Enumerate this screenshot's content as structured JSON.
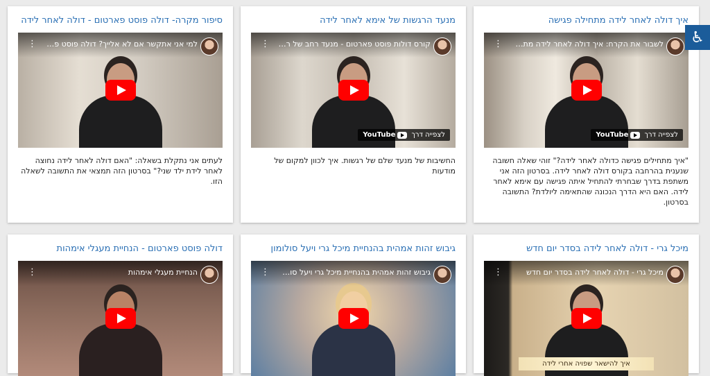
{
  "cards": [
    {
      "title": "איך דולה לאחר לידה מתחילה פגישה",
      "video_title": "לשבור את הקרח: איך דולה לאחר לידה מתחיל...",
      "watch_on": "לצפייה דרך",
      "youtube": "YouTube",
      "description": "\"איך מתחילים פגישה כדולה לאחר לידה?\" זוהי שאלה חשובה שנענית בהרחבה בקורס דולה לאחר לידה. בסרטון הזה אני משתפת בדרך שבחרתי להתחיל איתה פגישה עם אימא לאחר לידה. האם היא הדרך הנכונה שהתאימה ליולדת? התשובה בסרטון."
    },
    {
      "title": "מנעד הרגשות של אימא לאחר לידה",
      "video_title": "קורס דולות פוסט פארטום - מנעד רחב של רגשות",
      "watch_on": "לצפייה דרך",
      "youtube": "YouTube",
      "description": "החשיבות של מנעד שלם של רגשות. איך לכוון למקום של מודעות"
    },
    {
      "title": "סיפור מקרה- דולה פוסט פארטום - דולה לאחר לידה",
      "video_title": "למי אני אתקשר אם לא אלייך? דולה פוסט פארט...",
      "description": "לעתים אני נתקלת בשאלה: \"האם דולה לאחר לידה נחוצה לאחר לידת ילד שני?\" בסרטון הזה תמצאי את התשובה לשאלה הזו."
    },
    {
      "title": "מיכל גרי - דולה לאחר לידה בסדר יום חדש",
      "video_title": "מיכל גרי - דולה לאחר לידה בסדר יום חדש",
      "caption": "איך להישאר שפויה אחרי לידה"
    },
    {
      "title": "גיבוש זהות אמהית בהנחיית מיכל גרי ויעל סולומון",
      "video_title": "גיבוש זהות אמהית בהנחיית מיכל גרי ויעל סולו..."
    },
    {
      "title": "דולה פוסט פארטום - הנחיית מעגלי אימהות",
      "video_title": "הנחיית מעגלי אימהות"
    }
  ],
  "icons": {
    "kebab": "⋮",
    "accessibility": "♿"
  }
}
